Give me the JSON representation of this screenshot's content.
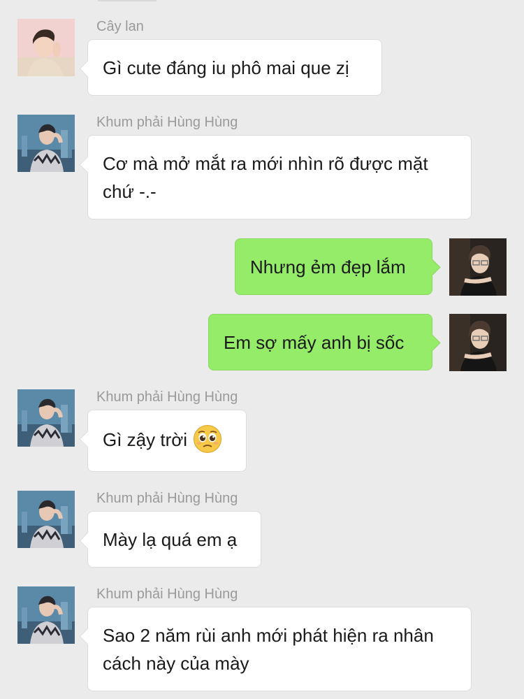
{
  "chat": {
    "messages": [
      {
        "sender": "Cây lan",
        "text": "Gì cute đáng iu phô mai que zị",
        "direction": "incoming",
        "avatar": "portrait-pink-background"
      },
      {
        "sender": "Khum phải Hùng Hùng",
        "text": "Cơ mà mở mắt ra mới nhìn rõ được mặt chứ -.-",
        "direction": "incoming",
        "avatar": "portrait-city-skyline"
      },
      {
        "sender": "",
        "text": "Nhưng ẻm đẹp lắm",
        "direction": "outgoing",
        "avatar": "portrait-dark-glasses"
      },
      {
        "sender": "",
        "text": "Em sợ mấy anh bị sốc",
        "direction": "outgoing",
        "avatar": "portrait-dark-glasses"
      },
      {
        "sender": "Khum phải Hùng Hùng",
        "text": "Gì zậy trời",
        "direction": "incoming",
        "avatar": "portrait-city-skyline",
        "emoji": "pleading-face-emoji"
      },
      {
        "sender": "Khum phải Hùng Hùng",
        "text": "Mày lạ quá em ạ",
        "direction": "incoming",
        "avatar": "portrait-city-skyline"
      },
      {
        "sender": "Khum phải Hùng Hùng",
        "text": "Sao 2 năm rùi anh mới phát hiện ra nhân cách này của mày",
        "direction": "incoming",
        "avatar": "portrait-city-skyline"
      }
    ]
  },
  "colors": {
    "background": "#ebebeb",
    "incoming_bubble": "#ffffff",
    "outgoing_bubble": "#95ec69",
    "sender_name": "#9a9a9a"
  }
}
